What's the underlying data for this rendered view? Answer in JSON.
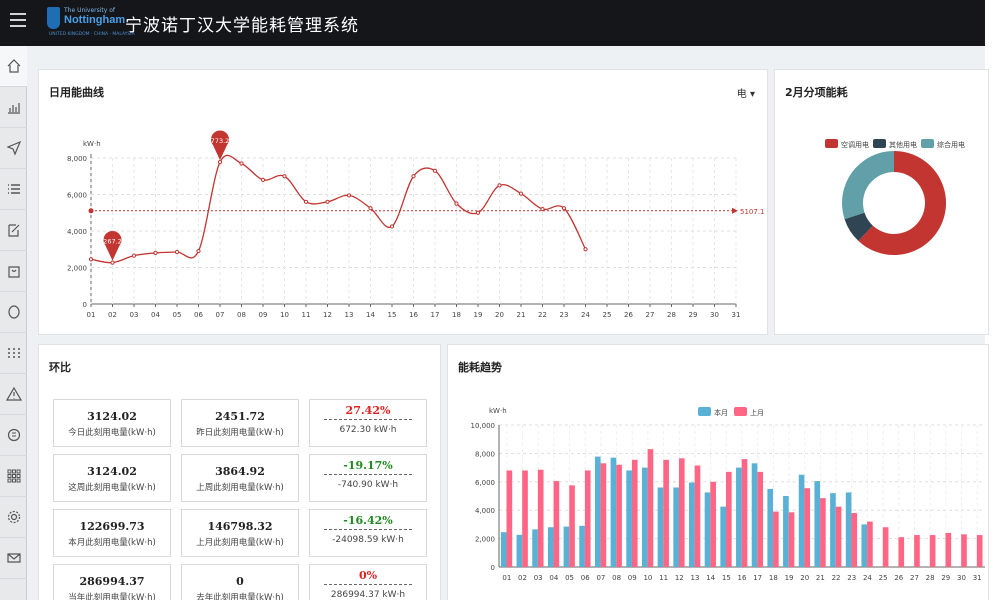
{
  "header": {
    "title": "宁波诺丁汉大学能耗管理系统",
    "logo": {
      "line1": "The University of",
      "line2": "Nottingham",
      "line3": "UNITED KINGDOM · CHINA · MALAYSIA"
    }
  },
  "sidebar": {
    "icons": [
      "home-icon",
      "bar-chart-icon",
      "send-icon",
      "list-icon",
      "edit-icon",
      "bag-icon",
      "circle-icon",
      "grid-dots-icon",
      "warning-icon",
      "coin-icon",
      "apps-icon",
      "settings-icon",
      "mail-icon"
    ]
  },
  "daily_curve": {
    "title": "日用能曲线",
    "selector_label": "电 ▾"
  },
  "category_energy": {
    "title": "2月分项能耗"
  },
  "comparison": {
    "title": "环比",
    "rows": [
      {
        "current_value": "3124.02",
        "current_label": "今日此刻用电量(kW·h)",
        "previous_value": "2451.72",
        "previous_label": "昨日此刻用电量(kW·h)",
        "percent": "27.42%",
        "trend": "up",
        "diff": "672.30 kW·h"
      },
      {
        "current_value": "3124.02",
        "current_label": "这周此刻用电量(kW·h)",
        "previous_value": "3864.92",
        "previous_label": "上周此刻用电量(kW·h)",
        "percent": "-19.17%",
        "trend": "down",
        "diff": "-740.90 kW·h"
      },
      {
        "current_value": "122699.73",
        "current_label": "本月此刻用电量(kW·h)",
        "previous_value": "146798.32",
        "previous_label": "上月此刻用电量(kW·h)",
        "percent": "-16.42%",
        "trend": "down",
        "diff": "-24098.59 kW·h"
      },
      {
        "current_value": "286994.37",
        "current_label": "当年此刻用电量(kW·h)",
        "previous_value": "0",
        "previous_label": "去年此刻用电量(kW·h)",
        "percent": "0%",
        "trend": "up",
        "diff": "286994.37 kW·h"
      }
    ]
  },
  "trend": {
    "title": "能耗趋势"
  },
  "chart_data": [
    {
      "type": "line",
      "title": "",
      "ylabel": "kW·h",
      "ylim": [
        0,
        8000
      ],
      "yticks": [
        "0",
        "2,000",
        "4,000",
        "6,000",
        "8,000"
      ],
      "categories": [
        "01",
        "02",
        "03",
        "04",
        "05",
        "06",
        "07",
        "08",
        "09",
        "10",
        "11",
        "12",
        "13",
        "14",
        "15",
        "16",
        "17",
        "18",
        "19",
        "20",
        "21",
        "22",
        "23",
        "24",
        "25",
        "26",
        "27",
        "28",
        "29",
        "30",
        "31"
      ],
      "values": [
        2450,
        2267.26,
        2650,
        2800,
        2850,
        2900,
        7773.28,
        7700,
        6800,
        7000,
        5600,
        5600,
        5950,
        5250,
        4250,
        7000,
        7300,
        5500,
        5000,
        6500,
        6050,
        5200,
        5250,
        3000
      ],
      "average": 5107.1,
      "average_label": "5107.1",
      "markers": [
        {
          "category": "02",
          "label": "2267.26"
        },
        {
          "category": "07",
          "label": "7773.28"
        }
      ],
      "grid": true,
      "color": "#c23531"
    },
    {
      "type": "pie",
      "title": "",
      "series": [
        {
          "name": "空调用电",
          "value": 62,
          "color": "#c23531"
        },
        {
          "name": "其他用电",
          "value": 8,
          "color": "#2f4554"
        },
        {
          "name": "综合用电",
          "value": 30,
          "color": "#61a0a8"
        }
      ],
      "legend": "top"
    },
    {
      "type": "bar",
      "title": "",
      "ylabel": "kW·h",
      "ylim": [
        0,
        10000
      ],
      "yticks": [
        "0",
        "2,000",
        "4,000",
        "6,000",
        "8,000",
        "10,000"
      ],
      "categories": [
        "01",
        "02",
        "03",
        "04",
        "05",
        "06",
        "07",
        "08",
        "09",
        "10",
        "11",
        "12",
        "13",
        "14",
        "15",
        "16",
        "17",
        "18",
        "19",
        "20",
        "21",
        "22",
        "23",
        "24",
        "25",
        "26",
        "27",
        "28",
        "29",
        "30",
        "31"
      ],
      "series": [
        {
          "name": "本月",
          "color": "#5ab1d6",
          "values": [
            2450,
            2267,
            2650,
            2800,
            2850,
            2900,
            7773,
            7700,
            6800,
            7000,
            5600,
            5600,
            5950,
            5250,
            4250,
            7000,
            7300,
            5500,
            5000,
            6500,
            6050,
            5200,
            5250,
            3000
          ]
        },
        {
          "name": "上月",
          "color": "#ff6685",
          "values": [
            6800,
            6800,
            6850,
            6050,
            5750,
            6800,
            7300,
            7200,
            7550,
            8300,
            7550,
            7650,
            7150,
            6000,
            6700,
            7600,
            6700,
            3900,
            3850,
            5550,
            4850,
            4250,
            3800,
            3200,
            2800,
            2100,
            2250,
            2250,
            2400,
            2300,
            2250
          ]
        }
      ],
      "legend": "top"
    }
  ]
}
